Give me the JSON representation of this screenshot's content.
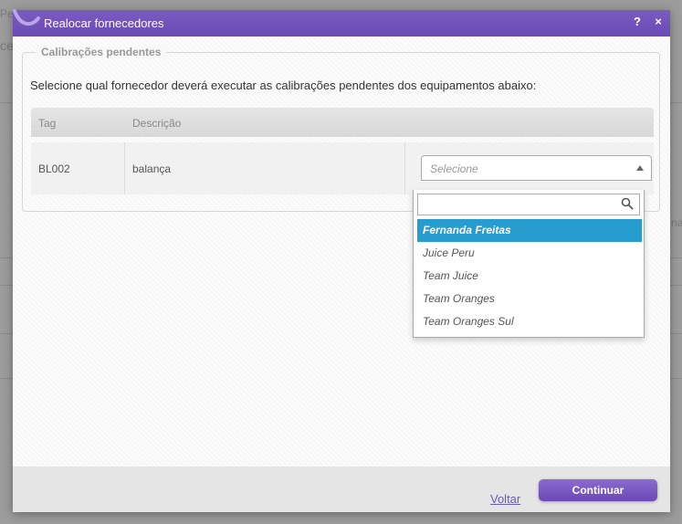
{
  "background": {
    "text_left_top": "Pes",
    "text_left_mid": "ce",
    "text_right_mid": "na"
  },
  "dialog": {
    "title": "Realocar fornecedores",
    "help": "?",
    "close": "×"
  },
  "panel": {
    "legend": "Calibrações pendentes",
    "instruction": "Selecione qual fornecedor deverá executar as calibrações pendentes dos equipamentos abaixo:"
  },
  "grid": {
    "columns": [
      "Tag",
      "Descrição"
    ],
    "rows": [
      {
        "tag": "BL002",
        "descricao": "balança",
        "fornecedor_placeholder": "Selecione"
      }
    ]
  },
  "dropdown": {
    "search_value": "",
    "options": [
      "Fernanda Freitas",
      "Juice Peru",
      "Team Juice",
      "Team Oranges",
      "Team Oranges Sul"
    ],
    "highlighted_index": 0
  },
  "footer": {
    "back_label": "Voltar",
    "continue_label": "Continuar"
  },
  "colors": {
    "titlebar": "#6a4bb4",
    "highlight": "#269ccf",
    "button": "#7a5bc2"
  }
}
